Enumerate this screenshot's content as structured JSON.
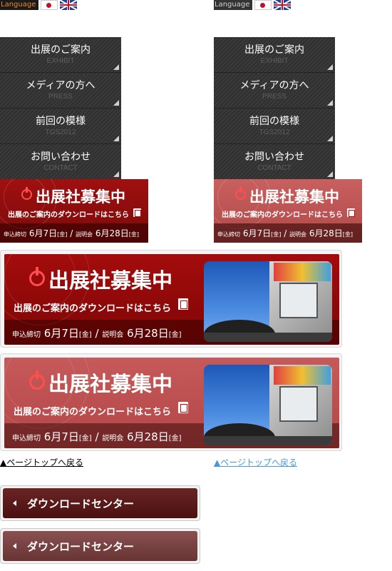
{
  "language_bar": {
    "label": "Language"
  },
  "menu": {
    "items": [
      {
        "jp": "出展のご案内",
        "en": "EXHIBIT"
      },
      {
        "jp": "メディアの方へ",
        "en": "PRESS"
      },
      {
        "jp": "前回の模様",
        "en": "TGS2012"
      },
      {
        "jp": "お問い合わせ",
        "en": "CONTACT"
      }
    ]
  },
  "banner": {
    "title": "出展社募集中",
    "download_text": "出展のご案内のダウンロードはこちら",
    "deadline_label": "申込締切",
    "deadline_month": "6月7日",
    "deadline_day": "[金]",
    "separator": "/",
    "briefing_label": "説明会",
    "briefing_month": "6月28日",
    "briefing_day": "[金]"
  },
  "page_top": {
    "label": "▲ページトップへ戻る"
  },
  "download_center": {
    "label": "ダウンロードセンター"
  },
  "colors": {
    "accent_red": "#a01010",
    "link_blue": "#4a98d8",
    "lang_orange": "#f08a1a"
  }
}
